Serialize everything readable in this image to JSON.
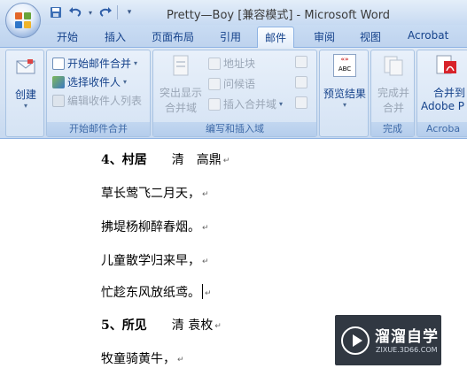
{
  "window": {
    "title": "Pretty—Boy [兼容模式] - Microsoft Word"
  },
  "quick_access": {
    "icons": [
      "save-icon",
      "undo-icon",
      "redo-icon",
      "customize-icon"
    ]
  },
  "tabs": [
    {
      "label": "开始"
    },
    {
      "label": "插入"
    },
    {
      "label": "页面布局"
    },
    {
      "label": "引用"
    },
    {
      "label": "邮件",
      "active": true
    },
    {
      "label": "审阅"
    },
    {
      "label": "视图"
    },
    {
      "label": "Acrobat"
    }
  ],
  "ribbon": {
    "create": {
      "label": "创建"
    },
    "start_merge": {
      "group_label": "开始邮件合并",
      "start_mail_merge": "开始邮件合并",
      "select_recipients": "选择收件人",
      "edit_recipients": "编辑收件人列表"
    },
    "write_insert": {
      "group_label": "编写和插入域",
      "highlight_line1": "突出显示",
      "highlight_line2": "合并域",
      "address_block": "地址块",
      "greeting_line": "问候语",
      "insert_merge_field": "插入合并域"
    },
    "preview": {
      "label": "预览结果",
      "icon_text": "ABC"
    },
    "finish": {
      "group_label": "完成",
      "line1": "完成并",
      "line2": "合并"
    },
    "acrobat": {
      "group_label": "Acroba",
      "line1": "合并到",
      "line2": "Adobe P"
    }
  },
  "document": {
    "lines": [
      {
        "text": "4、村居　　清　高鼎",
        "bold_part": "4、村居"
      },
      {
        "text": "草长莺飞二月天，"
      },
      {
        "text": "拂堤杨柳醉春烟。"
      },
      {
        "text": "儿童散学归来早，"
      },
      {
        "text": "忙趁东风放纸鸢。"
      },
      {
        "text": "5、所见　　清 袁枚",
        "bold_part": "5、所见"
      },
      {
        "text": "牧童骑黄牛，"
      }
    ],
    "paragraph_mark": "↵"
  },
  "watermark": {
    "title": "溜溜自学",
    "subtitle": "ZIXUE.3D66.COM"
  }
}
